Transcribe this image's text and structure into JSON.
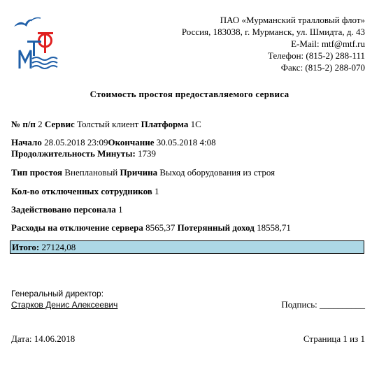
{
  "header": {
    "org_lines": [
      "ПАО «Мурманский тралловый флот»",
      "Россия, 183038, г. Мурманск, ул. Шмидта, д. 43",
      "E-Mail: mtf@mtf.ru",
      "Телефон: (815-2) 288-111",
      "Факс: (815-2) 288-070"
    ]
  },
  "document": {
    "title": "Стоимость простоя предоставляемого сервиса",
    "fields": {
      "num_label": "№ п/п",
      "num_value": "2",
      "service_label": "Сервис",
      "service_value": "Толстый клиент",
      "platform_label": "Платформа",
      "platform_value": "1С",
      "start_label": "Начало",
      "start_value": "28.05.2018 23:09",
      "end_label": "Окончание",
      "end_value": "30.05.2018 4:08",
      "duration_label": "Продолжительность Минуты:",
      "duration_value": "1739",
      "type_label": "Тип простоя",
      "type_value": "Внеплановый",
      "reason_label": "Причина",
      "reason_value": "Выход оборудования из строя",
      "employees_label": "Кол-во отключенных сотрудников",
      "employees_value": "1",
      "staff_label": "Задействовано персонала",
      "staff_value": "1",
      "costs_label": "Расходы на отключение сервера",
      "costs_value": "8565,37",
      "lost_label": "Потерянный доход",
      "lost_value": "18558,71",
      "total_label": "Итого:",
      "total_value": "27124,08"
    }
  },
  "footer": {
    "director_title": "Генеральный директор:",
    "director_name": "Старков Денис Алексеевич",
    "signature_label": "Подпись:",
    "signature_line": "__________",
    "date_label": "Дата:",
    "date_value": "14.06.2018",
    "page_text": "Страница 1 из 1"
  },
  "colors": {
    "total_bg": "#add8e6",
    "logo_blue": "#1f5fa8",
    "logo_red": "#e02020"
  }
}
